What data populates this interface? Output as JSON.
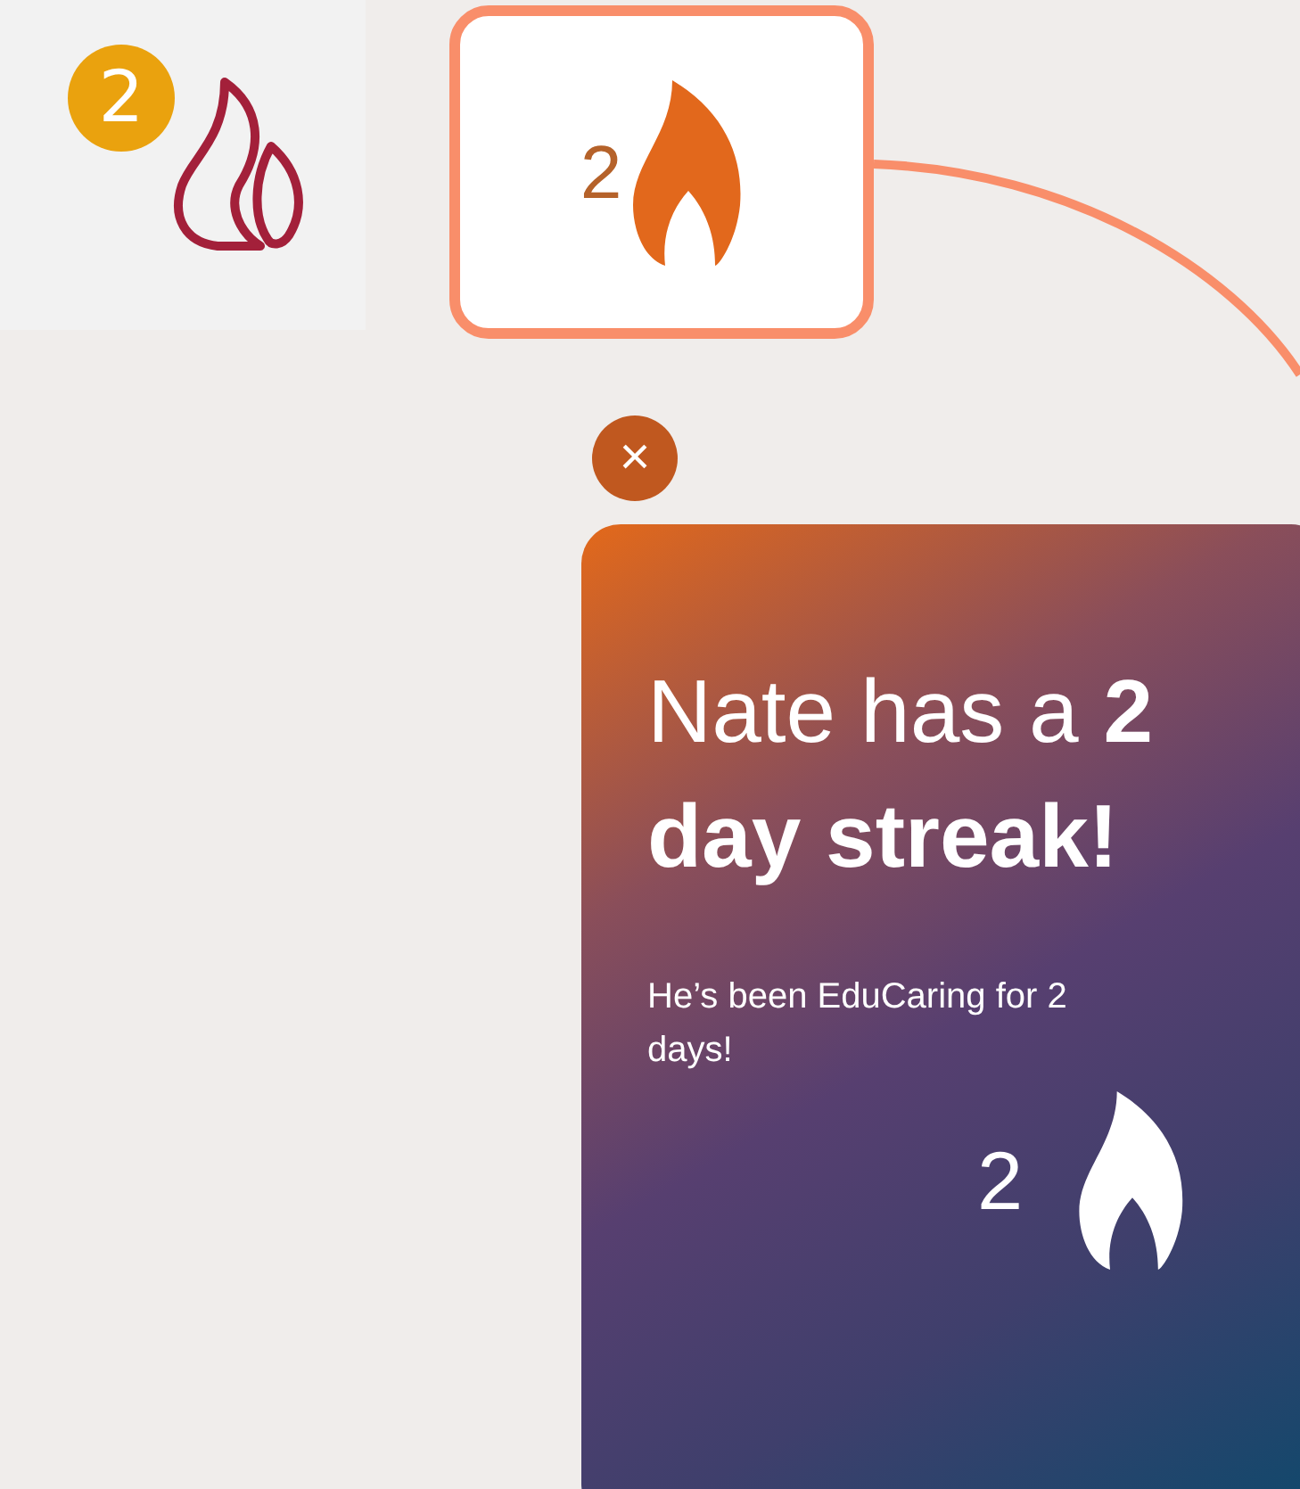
{
  "tiles": [
    {
      "kind": "outline",
      "badge": "2",
      "selected": false
    },
    {
      "kind": "filled",
      "count": "2",
      "selected": true
    }
  ],
  "close_button": {
    "label": "×"
  },
  "streak_card": {
    "title": "Nate has a **2 day streak!**",
    "message": "He’s been EduCaring for 2 days!",
    "count": "2"
  }
}
